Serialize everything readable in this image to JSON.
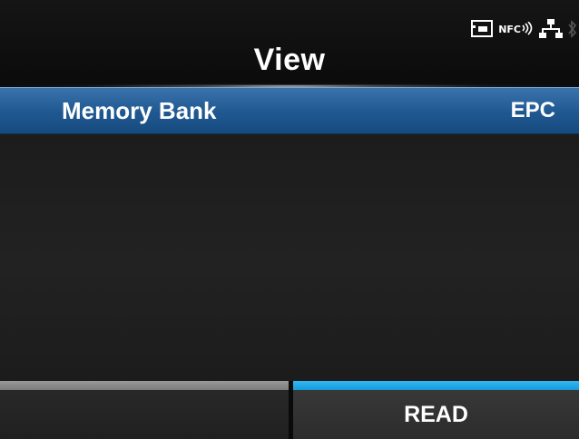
{
  "header": {
    "title": "View",
    "status_icons": [
      {
        "icon": "card-slot-icon"
      },
      {
        "icon": "nfc-icon",
        "text": "NFC"
      },
      {
        "icon": "network-lan-icon"
      },
      {
        "icon": "bluetooth-icon"
      }
    ]
  },
  "list": {
    "items": [
      {
        "label": "Memory Bank",
        "value": "EPC",
        "selected": true
      }
    ]
  },
  "softkeys": {
    "left": {
      "label": ""
    },
    "right": {
      "label": "READ"
    }
  },
  "colors": {
    "selection": "#1f5891",
    "softkey_accent": "#139bdc",
    "softkey_neutral": "#7b7b7b",
    "background": "#0a0a0a"
  }
}
